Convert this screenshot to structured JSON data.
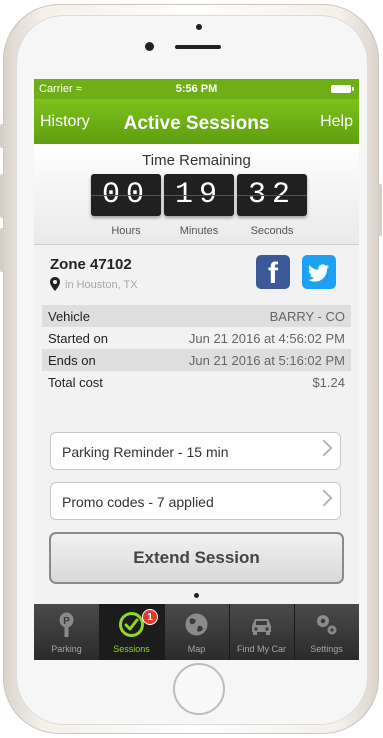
{
  "status_bar": {
    "carrier": "Carrier",
    "time": "5:56 PM"
  },
  "nav": {
    "left": "History",
    "title": "Active Sessions",
    "right": "Help"
  },
  "timer": {
    "label": "Time Remaining",
    "hours": "00",
    "minutes": "19",
    "seconds": "32",
    "hours_label": "Hours",
    "minutes_label": "Minutes",
    "seconds_label": "Seconds"
  },
  "zone": {
    "title": "Zone 47102",
    "location": "in Houston, TX"
  },
  "social": {
    "facebook_glyph": "f"
  },
  "details": [
    {
      "key": "Vehicle",
      "value": "BARRY - CO"
    },
    {
      "key": "Started on",
      "value": "Jun 21 2016 at 4:56:02 PM"
    },
    {
      "key": "Ends on",
      "value": "Jun 21 2016 at 5:16:02 PM"
    },
    {
      "key": "Total cost",
      "value": "$1.24"
    }
  ],
  "reminder": {
    "label": "Parking Reminder - 15 min"
  },
  "promo": {
    "label": "Promo codes - 7 applied"
  },
  "extend": {
    "label": "Extend Session"
  },
  "tabs": [
    {
      "label": "Parking",
      "icon": "parking-meter-icon"
    },
    {
      "label": "Sessions",
      "icon": "clock-check-icon",
      "badge": "1"
    },
    {
      "label": "Map",
      "icon": "globe-icon"
    },
    {
      "label": "Find My Car",
      "icon": "car-icon"
    },
    {
      "label": "Settings",
      "icon": "gears-icon"
    }
  ],
  "colors": {
    "accent": "#6fae17",
    "active_tab": "#8fd62a",
    "badge": "#e23a2a",
    "facebook": "#3b5998",
    "twitter": "#1da1f2"
  }
}
